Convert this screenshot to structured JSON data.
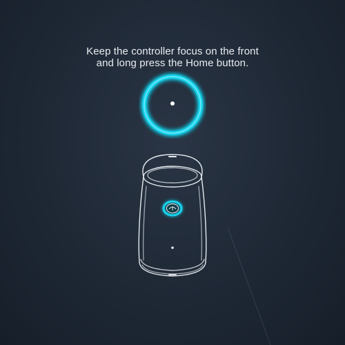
{
  "instruction": {
    "line1": "Keep the controller focus on the front",
    "line2": "and long press the Home button."
  },
  "colors": {
    "background": "#1e2835",
    "accent": "#19d3ec",
    "text": "#e9edf2",
    "outline": "#e6ebf0"
  },
  "icons": {
    "focus_ring": "focus-ring-icon",
    "controller": "vr-controller-icon",
    "home_button": "home-button-icon"
  }
}
